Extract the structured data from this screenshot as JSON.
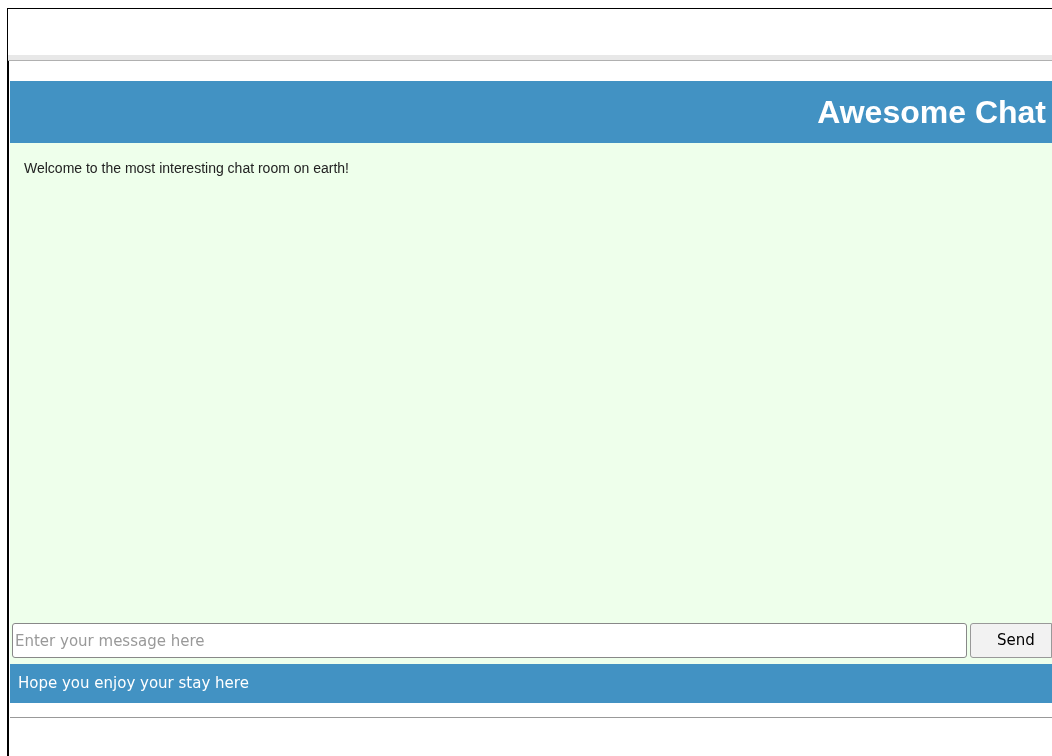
{
  "header": {
    "title": "Awesome Chat"
  },
  "messages": [
    "Welcome to the most interesting chat room on earth!"
  ],
  "composer": {
    "placeholder": "Enter your message here",
    "button": "Send"
  },
  "footer": {
    "text": "Hope you enjoy your stay here"
  }
}
